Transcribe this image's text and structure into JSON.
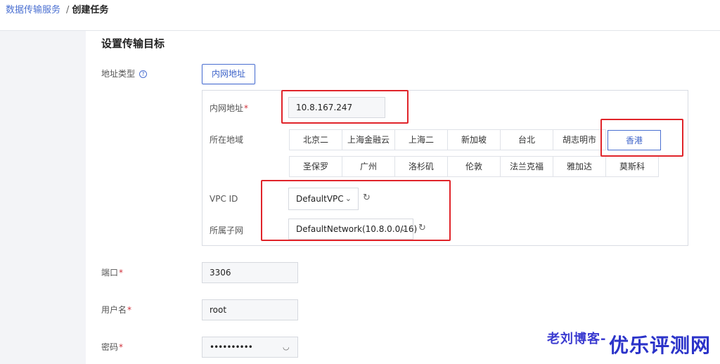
{
  "breadcrumb": {
    "parent": "数据传输服务",
    "separator": "/",
    "current": "创建任务"
  },
  "section_title": "设置传输目标",
  "address_type": {
    "label": "地址类型",
    "help_icon": "question-circle-icon",
    "value": "内网地址"
  },
  "intranet_address": {
    "label": "内网地址",
    "required_mark": "*",
    "value": "10.8.167.247"
  },
  "region": {
    "label": "所在地域",
    "row1": [
      "北京二",
      "上海金融云",
      "上海二",
      "新加坡",
      "台北",
      "胡志明市",
      "香港"
    ],
    "row2": [
      "圣保罗",
      "广州",
      "洛杉矶",
      "伦敦",
      "法兰克福",
      "雅加达",
      "莫斯科"
    ],
    "selected": "香港"
  },
  "vpc": {
    "label": "VPC ID",
    "value": "DefaultVPC",
    "refresh_icon": "refresh-icon"
  },
  "subnet": {
    "label": "所属子网",
    "value": "DefaultNetwork(10.8.0.0/16)",
    "refresh_icon": "refresh-icon"
  },
  "port": {
    "label": "端口",
    "required_mark": "*",
    "value": "3306"
  },
  "username": {
    "label": "用户名",
    "required_mark": "*",
    "value": "root"
  },
  "password": {
    "label": "密码",
    "required_mark": "*",
    "value": "••••••••••",
    "toggle_icon": "eye-closed-icon"
  },
  "watermark": {
    "left": "老刘博客-",
    "right": "优乐评测网"
  },
  "colors": {
    "accent": "#4a6fd1",
    "highlight": "#e0242a",
    "required": "#d0303a"
  }
}
